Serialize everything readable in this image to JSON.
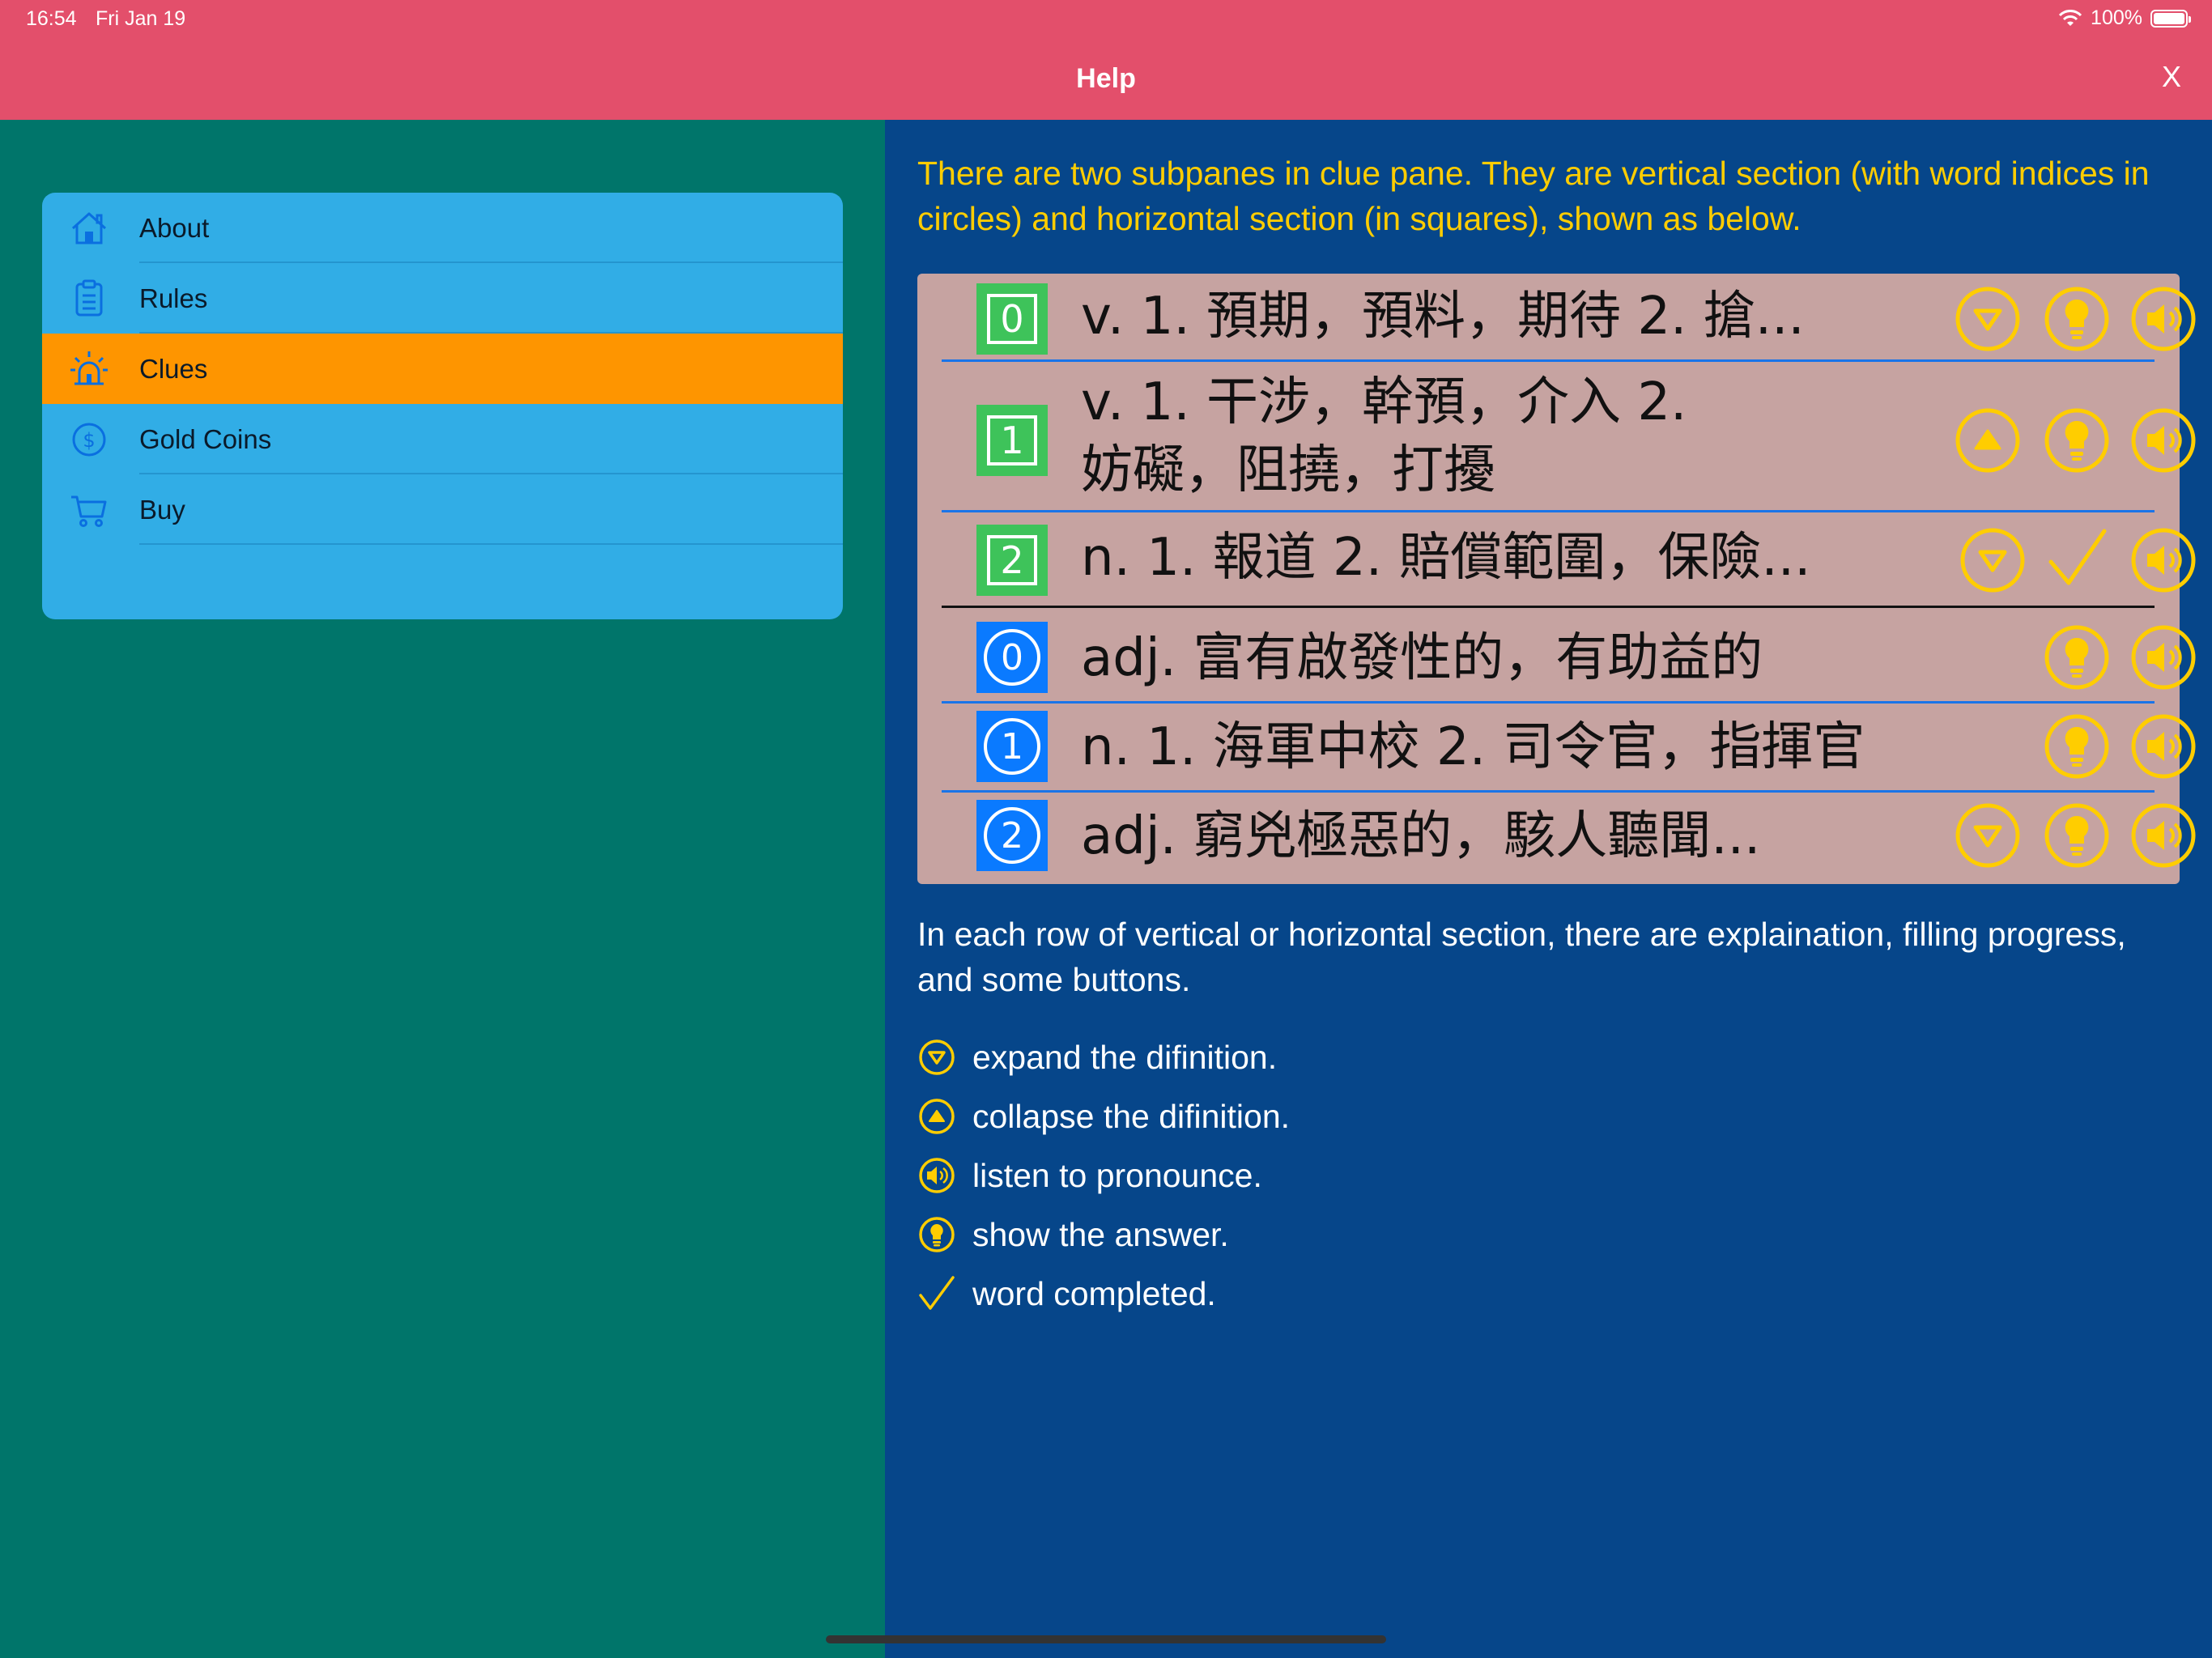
{
  "status": {
    "time": "16:54",
    "date": "Fri Jan 19",
    "battery": "100%"
  },
  "nav": {
    "title": "Help",
    "close": "X"
  },
  "menu": {
    "items": [
      {
        "label": "About",
        "icon": "house-icon"
      },
      {
        "label": "Rules",
        "icon": "clipboard-icon"
      },
      {
        "label": "Clues",
        "icon": "alarm-light-icon",
        "active": true
      },
      {
        "label": "Gold Coins",
        "icon": "dollar-coin-icon"
      },
      {
        "label": "Buy",
        "icon": "cart-icon"
      }
    ]
  },
  "help": {
    "intro": "There are two subpanes in clue pane. They are vertical section (with word indices in circles) and horizontal section (in squares), shown as below.",
    "paragraph": "In each row of vertical or horizontal section, there are explaination, filling progress, and some buttons."
  },
  "clues": {
    "horizontal": [
      {
        "index": "0",
        "text": "v. 1. 預期，預料，期待 2. 搶...",
        "toggle": "expand",
        "state": "hint"
      },
      {
        "index": "1",
        "text_line1": "v. 1. 干涉，幹預，介入 2.",
        "text_line2": "妨礙，阻撓，打擾",
        "toggle": "collapse",
        "state": "hint"
      },
      {
        "index": "2",
        "text": "n. 1. 報道 2. 賠償範圍，保險...",
        "toggle": "expand",
        "state": "completed"
      }
    ],
    "vertical": [
      {
        "index": "0",
        "text": "adj. 富有啟發性的，有助益的",
        "toggle": "none",
        "state": "hint"
      },
      {
        "index": "1",
        "text": "n. 1. 海軍中校 2. 司令官，指揮官",
        "toggle": "none",
        "state": "hint"
      },
      {
        "index": "2",
        "text": "adj. 窮兇極惡的，駭人聽聞...",
        "toggle": "expand",
        "state": "hint"
      }
    ]
  },
  "legend": [
    {
      "icon": "expand-icon",
      "label": "expand the difinition."
    },
    {
      "icon": "collapse-icon",
      "label": "collapse the difinition."
    },
    {
      "icon": "speaker-icon",
      "label": "listen to pronounce."
    },
    {
      "icon": "bulb-icon",
      "label": "show the answer."
    },
    {
      "icon": "checkmark-icon",
      "label": "word completed."
    }
  ],
  "colors": {
    "topbar": "#e34f6b",
    "left_bg": "#00756a",
    "right_bg": "#06468a",
    "menu_bg": "#31ade6",
    "menu_active": "#fe9500",
    "accent_yellow": "#ffcd00",
    "clue_bg": "#c6a3a1",
    "square_index": "#3ec35a",
    "circle_index": "#0a7aff"
  }
}
